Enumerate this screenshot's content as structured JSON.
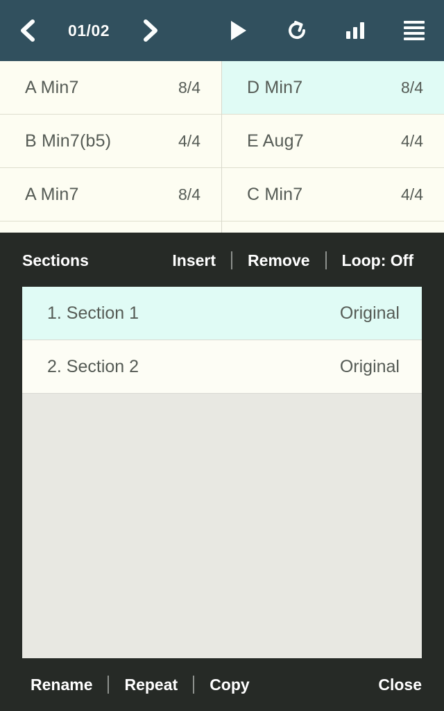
{
  "toolbar": {
    "prev_icon": "chevron-left-icon",
    "page_indicator": "01/02",
    "next_icon": "chevron-right-icon",
    "play_icon": "play-icon",
    "loop_icon": "restart-loop-icon",
    "level_icon": "bar-levels-icon",
    "menu_icon": "hamburger-menu-icon",
    "background": "#31505e"
  },
  "chord_grid": {
    "columns": [
      {
        "cells": [
          {
            "chord": "A Min7",
            "signature": "8/4",
            "selected": false
          },
          {
            "chord": "B Min7(b5)",
            "signature": "4/4",
            "selected": false
          },
          {
            "chord": "A Min7",
            "signature": "8/4",
            "selected": false
          },
          {
            "chord": "",
            "signature": "",
            "selected": false
          }
        ]
      },
      {
        "cells": [
          {
            "chord": "D Min7",
            "signature": "8/4",
            "selected": true
          },
          {
            "chord": "E Aug7",
            "signature": "4/4",
            "selected": false
          },
          {
            "chord": "C Min7",
            "signature": "4/4",
            "selected": false
          },
          {
            "chord": "",
            "signature": "",
            "selected": false
          }
        ]
      }
    ],
    "selected_color": "#e0fbf5",
    "cell_color": "#fdfdf2"
  },
  "sections_panel": {
    "title": "Sections",
    "background": "#262a26",
    "header_actions": [
      {
        "label": "Insert"
      },
      {
        "label": "Remove"
      },
      {
        "label": "Loop: Off"
      }
    ],
    "list": [
      {
        "index_label": "1. Section 1",
        "tag": "Original",
        "selected": true
      },
      {
        "index_label": "2. Section 2",
        "tag": "Original",
        "selected": false
      }
    ],
    "list_background": "#e8e8e2",
    "footer_actions": [
      {
        "label": "Rename"
      },
      {
        "label": "Repeat"
      },
      {
        "label": "Copy"
      }
    ],
    "close_label": "Close"
  }
}
